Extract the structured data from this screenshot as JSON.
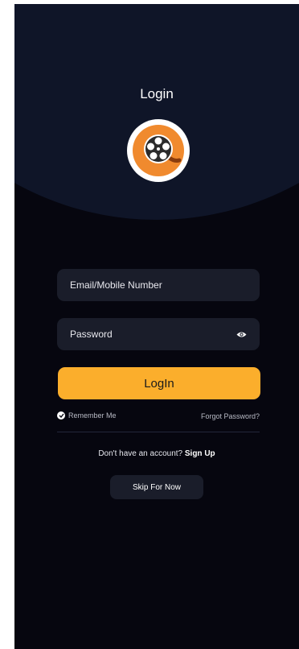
{
  "header": {
    "title": "Login",
    "logo_icon": "film-reel-icon"
  },
  "form": {
    "email_placeholder": "Email/Mobile Number",
    "password_placeholder": "Password",
    "password_toggle_icon": "eye-icon",
    "login_label": "LogIn",
    "remember_label": "Remember Me",
    "remember_checked": true,
    "forgot_label": "Forgot Password?"
  },
  "footer": {
    "signup_prompt": "Don't have an account?",
    "signup_link": "Sign Up",
    "skip_label": "Skip For Now"
  },
  "colors": {
    "background": "#06060f",
    "header_arc": "#0f1528",
    "field": "#1a1d2a",
    "accent": "#fbae2c",
    "logo_orange": "#f08a2e"
  }
}
